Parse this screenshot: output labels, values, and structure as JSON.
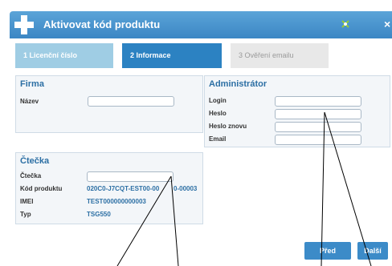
{
  "dialog": {
    "title": "Aktivovat kód produktu",
    "colors": {
      "title_bar": "#3b86c4",
      "accent": "#2c82c2",
      "label": "#2c6fa4"
    }
  },
  "wizard": {
    "steps": [
      {
        "label": "1 Licenční číslo",
        "state": "done"
      },
      {
        "label": "2 Informace",
        "state": "active"
      },
      {
        "label": "3 Ověření emailu",
        "state": "pending"
      }
    ]
  },
  "firma": {
    "title": "Firma",
    "name_label": "Název",
    "name_value": ""
  },
  "admin": {
    "title": "Administrátor",
    "login_label": "Login",
    "password_label": "Heslo",
    "password_again_label": "Heslo znovu",
    "email_label": "Email"
  },
  "ctecka": {
    "title": "Čtečka",
    "reader_label": "Čtečka",
    "product_label": "Kód produktu",
    "product_value": "020C0-J7CQT-EST00-00",
    "product_value_tail": "0-00003",
    "imei_label": "IMEI",
    "imei_value": "TEST000000000003",
    "type_label": "Typ",
    "type_value": "TSG550"
  },
  "buttons": {
    "prev_label": "Před",
    "next_label": "Další"
  },
  "icons": {
    "app": "plus-icon",
    "minimize": "minimize-icon",
    "close": "close-icon"
  }
}
